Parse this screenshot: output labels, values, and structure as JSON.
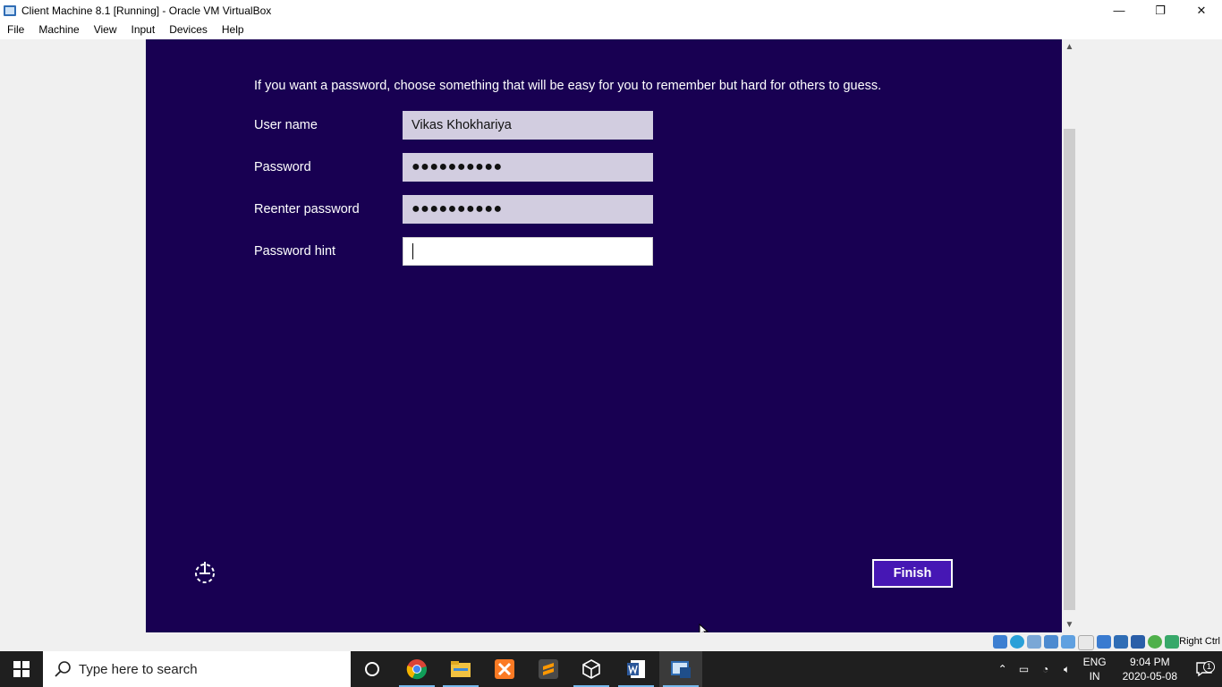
{
  "window": {
    "title": "Client Machine 8.1 [Running] - Oracle VM VirtualBox",
    "minimize": "—",
    "restore": "❐",
    "close": "✕"
  },
  "menu": [
    "File",
    "Machine",
    "View",
    "Input",
    "Devices",
    "Help"
  ],
  "vm": {
    "intro": "If you want a password, choose something that will be easy for you to remember but hard for others to guess.",
    "fields": [
      {
        "label": "User name",
        "value": "Vikas Khokhariya"
      },
      {
        "label": "Password",
        "value": "●●●●●●●●●●"
      },
      {
        "label": "Reenter password",
        "value": "●●●●●●●●●●"
      },
      {
        "label": "Password hint",
        "value": ""
      }
    ],
    "finish_label": "Finish"
  },
  "statusbar": {
    "host_key": "Right Ctrl"
  },
  "taskbar": {
    "search_placeholder": "Type here to search",
    "lang_line1": "ENG",
    "lang_line2": "IN",
    "time": "9:04 PM",
    "date": "2020-05-08",
    "notification_count": "1"
  }
}
